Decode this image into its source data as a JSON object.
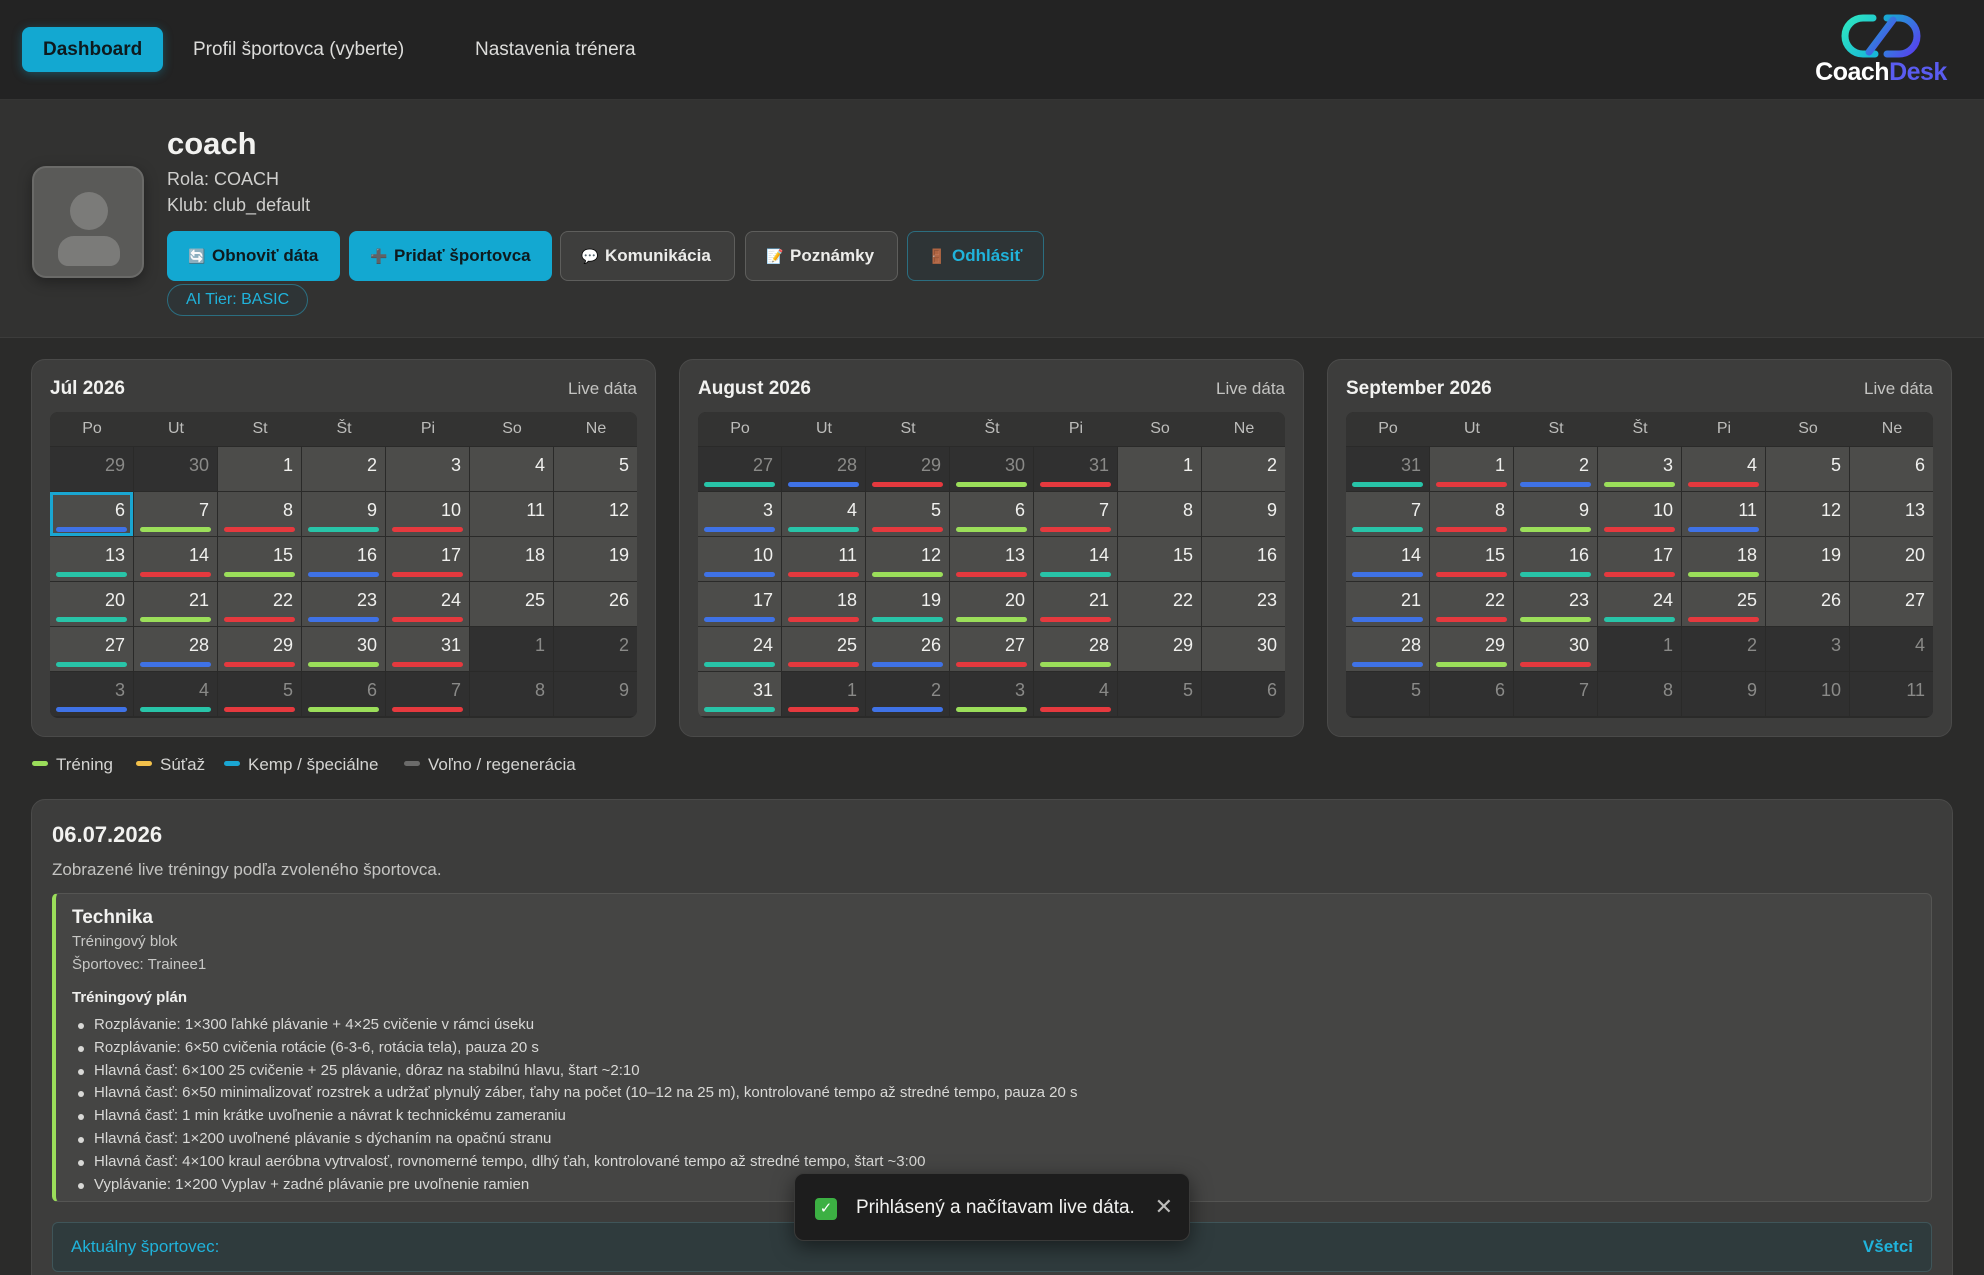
{
  "nav": {
    "items": [
      {
        "label": "Dashboard",
        "active": true
      },
      {
        "label": "Profil športovca (vyberte)",
        "active": false
      },
      {
        "label": "Nastavenia trénera",
        "active": false
      }
    ],
    "logo": {
      "part1": "Coach",
      "part2": "Desk"
    }
  },
  "profile": {
    "name": "coach",
    "role": "Rola: COACH",
    "club": "Klub: club_default",
    "buttons": {
      "refresh": {
        "label": "Obnoviť dáta",
        "icon": "refresh-icon"
      },
      "add_athlete": {
        "label": "Pridať športovca",
        "icon": "plus-icon"
      },
      "communication": {
        "label": "Komunikácia",
        "icon": "speech-bubble-icon"
      },
      "notes": {
        "label": "Poznámky",
        "icon": "memo-icon"
      },
      "logout": {
        "label": "Odhlásiť",
        "icon": "door-icon"
      }
    },
    "tier": "AI Tier:  BASIC"
  },
  "calendar": {
    "weekday_labels": [
      "Po",
      "Ut",
      "St",
      "Št",
      "Pi",
      "So",
      "Ne"
    ],
    "live_label": "Live dáta",
    "colors": {
      "training": "#9bde5a",
      "competition": "#f3c14b",
      "camp": "#1aa6d2",
      "rest": "#6b6b6a",
      "teal": "#28c4a8",
      "blue": "#3f72e6",
      "red": "#e5393e",
      "lime": "#9bde5a"
    },
    "months": [
      {
        "title": "Júl 2026",
        "weeks": [
          [
            {
              "d": "29",
              "o": true
            },
            {
              "d": "30",
              "o": true
            },
            {
              "d": "1"
            },
            {
              "d": "2"
            },
            {
              "d": "3"
            },
            {
              "d": "4"
            },
            {
              "d": "5"
            }
          ],
          [
            {
              "d": "6",
              "b": "blue",
              "sel": true
            },
            {
              "d": "7",
              "b": "lime"
            },
            {
              "d": "8",
              "b": "red"
            },
            {
              "d": "9",
              "b": "teal"
            },
            {
              "d": "10",
              "b": "red"
            },
            {
              "d": "11"
            },
            {
              "d": "12"
            }
          ],
          [
            {
              "d": "13",
              "b": "teal"
            },
            {
              "d": "14",
              "b": "red"
            },
            {
              "d": "15",
              "b": "lime"
            },
            {
              "d": "16",
              "b": "blue"
            },
            {
              "d": "17",
              "b": "red"
            },
            {
              "d": "18"
            },
            {
              "d": "19"
            }
          ],
          [
            {
              "d": "20",
              "b": "teal"
            },
            {
              "d": "21",
              "b": "lime"
            },
            {
              "d": "22",
              "b": "red"
            },
            {
              "d": "23",
              "b": "blue"
            },
            {
              "d": "24",
              "b": "red"
            },
            {
              "d": "25"
            },
            {
              "d": "26"
            }
          ],
          [
            {
              "d": "27",
              "b": "teal"
            },
            {
              "d": "28",
              "b": "blue"
            },
            {
              "d": "29",
              "b": "red"
            },
            {
              "d": "30",
              "b": "lime"
            },
            {
              "d": "31",
              "b": "red"
            },
            {
              "d": "1",
              "o": true
            },
            {
              "d": "2",
              "o": true
            }
          ],
          [
            {
              "d": "3",
              "o": true,
              "b": "blue"
            },
            {
              "d": "4",
              "o": true,
              "b": "teal"
            },
            {
              "d": "5",
              "o": true,
              "b": "red"
            },
            {
              "d": "6",
              "o": true,
              "b": "lime"
            },
            {
              "d": "7",
              "o": true,
              "b": "red"
            },
            {
              "d": "8",
              "o": true
            },
            {
              "d": "9",
              "o": true
            }
          ]
        ]
      },
      {
        "title": "August 2026",
        "weeks": [
          [
            {
              "d": "27",
              "o": true,
              "b": "teal"
            },
            {
              "d": "28",
              "o": true,
              "b": "blue"
            },
            {
              "d": "29",
              "o": true,
              "b": "red"
            },
            {
              "d": "30",
              "o": true,
              "b": "lime"
            },
            {
              "d": "31",
              "o": true,
              "b": "red"
            },
            {
              "d": "1"
            },
            {
              "d": "2"
            }
          ],
          [
            {
              "d": "3",
              "b": "blue"
            },
            {
              "d": "4",
              "b": "teal"
            },
            {
              "d": "5",
              "b": "red"
            },
            {
              "d": "6",
              "b": "lime"
            },
            {
              "d": "7",
              "b": "red"
            },
            {
              "d": "8"
            },
            {
              "d": "9"
            }
          ],
          [
            {
              "d": "10",
              "b": "blue"
            },
            {
              "d": "11",
              "b": "red"
            },
            {
              "d": "12",
              "b": "lime"
            },
            {
              "d": "13",
              "b": "red"
            },
            {
              "d": "14",
              "b": "teal"
            },
            {
              "d": "15"
            },
            {
              "d": "16"
            }
          ],
          [
            {
              "d": "17",
              "b": "blue"
            },
            {
              "d": "18",
              "b": "red"
            },
            {
              "d": "19",
              "b": "teal"
            },
            {
              "d": "20",
              "b": "lime"
            },
            {
              "d": "21",
              "b": "red"
            },
            {
              "d": "22"
            },
            {
              "d": "23"
            }
          ],
          [
            {
              "d": "24",
              "b": "teal"
            },
            {
              "d": "25",
              "b": "red"
            },
            {
              "d": "26",
              "b": "blue"
            },
            {
              "d": "27",
              "b": "red"
            },
            {
              "d": "28",
              "b": "lime"
            },
            {
              "d": "29"
            },
            {
              "d": "30"
            }
          ],
          [
            {
              "d": "31",
              "b": "teal"
            },
            {
              "d": "1",
              "o": true,
              "b": "red"
            },
            {
              "d": "2",
              "o": true,
              "b": "blue"
            },
            {
              "d": "3",
              "o": true,
              "b": "lime"
            },
            {
              "d": "4",
              "o": true,
              "b": "red"
            },
            {
              "d": "5",
              "o": true
            },
            {
              "d": "6",
              "o": true
            }
          ]
        ]
      },
      {
        "title": "September 2026",
        "weeks": [
          [
            {
              "d": "31",
              "o": true,
              "b": "teal"
            },
            {
              "d": "1",
              "b": "red"
            },
            {
              "d": "2",
              "b": "blue"
            },
            {
              "d": "3",
              "b": "lime"
            },
            {
              "d": "4",
              "b": "red"
            },
            {
              "d": "5"
            },
            {
              "d": "6"
            }
          ],
          [
            {
              "d": "7",
              "b": "teal"
            },
            {
              "d": "8",
              "b": "red"
            },
            {
              "d": "9",
              "b": "lime"
            },
            {
              "d": "10",
              "b": "red"
            },
            {
              "d": "11",
              "b": "blue"
            },
            {
              "d": "12"
            },
            {
              "d": "13"
            }
          ],
          [
            {
              "d": "14",
              "b": "blue"
            },
            {
              "d": "15",
              "b": "red"
            },
            {
              "d": "16",
              "b": "teal"
            },
            {
              "d": "17",
              "b": "red"
            },
            {
              "d": "18",
              "b": "lime"
            },
            {
              "d": "19"
            },
            {
              "d": "20"
            }
          ],
          [
            {
              "d": "21",
              "b": "blue"
            },
            {
              "d": "22",
              "b": "red"
            },
            {
              "d": "23",
              "b": "lime"
            },
            {
              "d": "24",
              "b": "teal"
            },
            {
              "d": "25",
              "b": "red"
            },
            {
              "d": "26"
            },
            {
              "d": "27"
            }
          ],
          [
            {
              "d": "28",
              "b": "blue"
            },
            {
              "d": "29",
              "b": "lime"
            },
            {
              "d": "30",
              "b": "red"
            },
            {
              "d": "1",
              "o": true
            },
            {
              "d": "2",
              "o": true
            },
            {
              "d": "3",
              "o": true
            },
            {
              "d": "4",
              "o": true
            }
          ],
          [
            {
              "d": "5",
              "o": true
            },
            {
              "d": "6",
              "o": true
            },
            {
              "d": "7",
              "o": true
            },
            {
              "d": "8",
              "o": true
            },
            {
              "d": "9",
              "o": true
            },
            {
              "d": "10",
              "o": true
            },
            {
              "d": "11",
              "o": true
            }
          ]
        ]
      }
    ]
  },
  "legend": [
    {
      "label": "Tréning",
      "color": "#9bde5a"
    },
    {
      "label": "Súťaž",
      "color": "#f3c14b"
    },
    {
      "label": "Kemp / špeciálne",
      "color": "#1aa6d2"
    },
    {
      "label": "Voľno / regenerácia",
      "color": "#6b6b6a"
    }
  ],
  "detail": {
    "date": "06.07.2026",
    "subtitle": "Zobrazené live tréningy podľa zvoleného športovca.",
    "training": {
      "title": "Technika",
      "block": "Tréningový blok",
      "athlete": "Športovec: Trainee1",
      "plan_heading": "Tréningový plán",
      "plan": [
        "Rozplávanie: 1×300 ľahké plávanie + 4×25 cvičenie v rámci úseku",
        "Rozplávanie: 6×50 cvičenia rotácie (6-3-6, rotácia tela), pauza 20 s",
        "Hlavná časť: 6×100 25 cvičenie + 25 plávanie, dôraz na stabilnú hlavu, štart ~2:10",
        "Hlavná časť: 6×50 minimalizovať rozstrek a udržať plynulý záber, ťahy na počet (10–12 na 25 m), kontrolované tempo až stredné tempo, pauza 20 s",
        "Hlavná časť: 1 min krátke uvoľnenie a návrat k technickému zameraniu",
        "Hlavná časť: 1×200 uvoľnené plávanie s dýchaním na opačnú stranu",
        "Hlavná časť: 4×100 kraul aeróbna vytrvalosť, rovnomerné tempo, dlhý ťah, kontrolované tempo až stredné tempo, štart ~3:00",
        "Vyplávanie: 1×200 Vyplav + zadné plávanie pre uvoľnenie ramien"
      ]
    },
    "current_athlete_label": "Aktuálny športovec:",
    "current_athlete_value": "Všetci"
  },
  "toast": {
    "message": "Prihlásený a načítavam live dáta.",
    "icon": "check-icon",
    "close_icon": "close-icon"
  }
}
